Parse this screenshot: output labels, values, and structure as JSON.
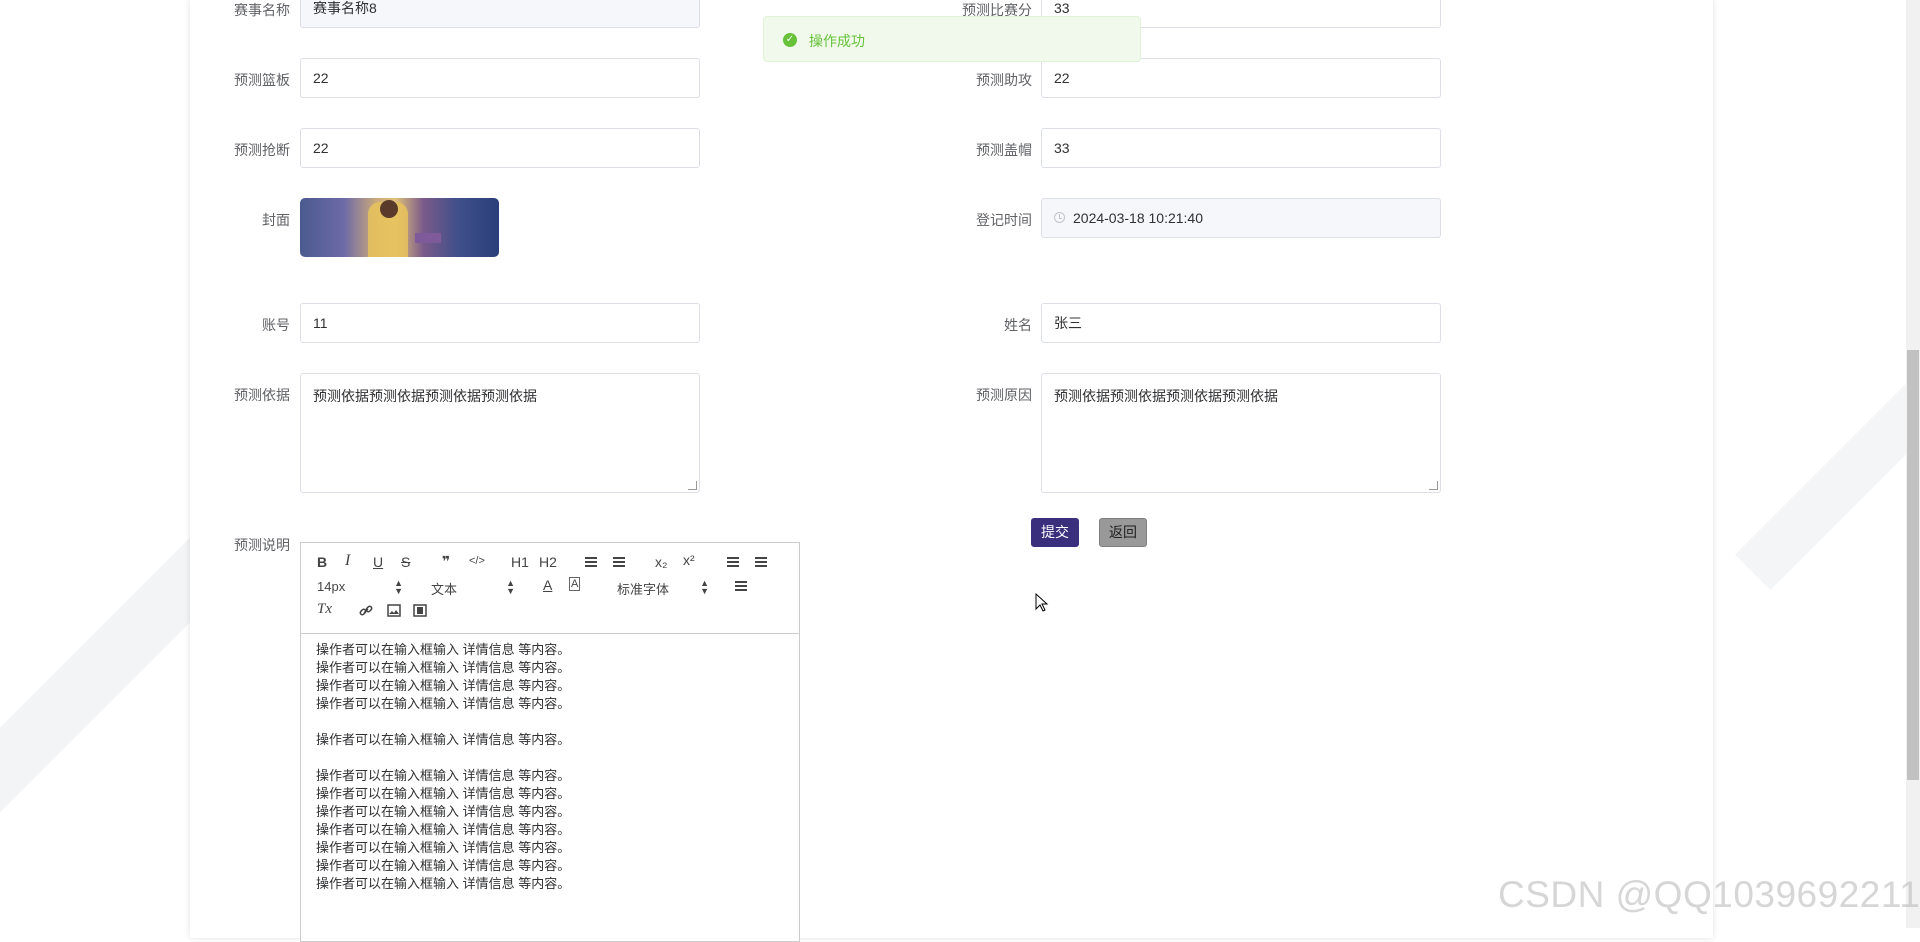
{
  "toast": {
    "message": "操作成功"
  },
  "form": {
    "match_name": {
      "label": "赛事名称",
      "value": "赛事名称8"
    },
    "pred_score": {
      "label": "预测比赛分",
      "value": "33"
    },
    "pred_rebound": {
      "label": "预测篮板",
      "value": "22"
    },
    "pred_assist": {
      "label": "预测助攻",
      "value": "22"
    },
    "pred_steal": {
      "label": "预测抢断",
      "value": "22"
    },
    "pred_block": {
      "label": "预测盖帽",
      "value": "33"
    },
    "cover": {
      "label": "封面"
    },
    "register_time": {
      "label": "登记时间",
      "value": "2024-03-18 10:21:40"
    },
    "account": {
      "label": "账号",
      "value": "11"
    },
    "name": {
      "label": "姓名",
      "value": "张三"
    },
    "pred_basis": {
      "label": "预测依据",
      "value": "预测依据预测依据预测依据预测依据"
    },
    "pred_reason": {
      "label": "预测原因",
      "value": "预测依据预测依据预测依据预测依据"
    },
    "pred_desc": {
      "label": "预测说明"
    }
  },
  "buttons": {
    "submit": "提交",
    "back": "返回"
  },
  "editor": {
    "toolbar": {
      "bold": "B",
      "italic": "I",
      "underline": "U",
      "strike": "S",
      "blockquote": "❞",
      "code": "</>",
      "h1": "H1",
      "h2": "H2",
      "subscript": "x₂",
      "superscript": "x²",
      "size": "14px",
      "header": "文本",
      "font": "标准字体",
      "color_a": "A",
      "bg_a": "A",
      "clean": "Tx"
    },
    "lines": [
      "操作者可以在输入框输入  详情信息  等内容。",
      "操作者可以在输入框输入  详情信息  等内容。",
      "操作者可以在输入框输入  详情信息  等内容。",
      "操作者可以在输入框输入  详情信息  等内容。",
      "",
      "操作者可以在输入框输入  详情信息  等内容。",
      "",
      "操作者可以在输入框输入  详情信息  等内容。",
      "操作者可以在输入框输入  详情信息  等内容。",
      "操作者可以在输入框输入  详情信息  等内容。",
      "操作者可以在输入框输入  详情信息  等内容。",
      "操作者可以在输入框输入  详情信息  等内容。",
      "操作者可以在输入框输入  详情信息  等内容。",
      "操作者可以在输入框输入  详情信息  等内容。"
    ]
  },
  "watermark": "CSDN @QQ1039692211",
  "colors": {
    "primary": "#3a2f7d",
    "success": "#67c23a",
    "border": "#dcdfe6"
  }
}
